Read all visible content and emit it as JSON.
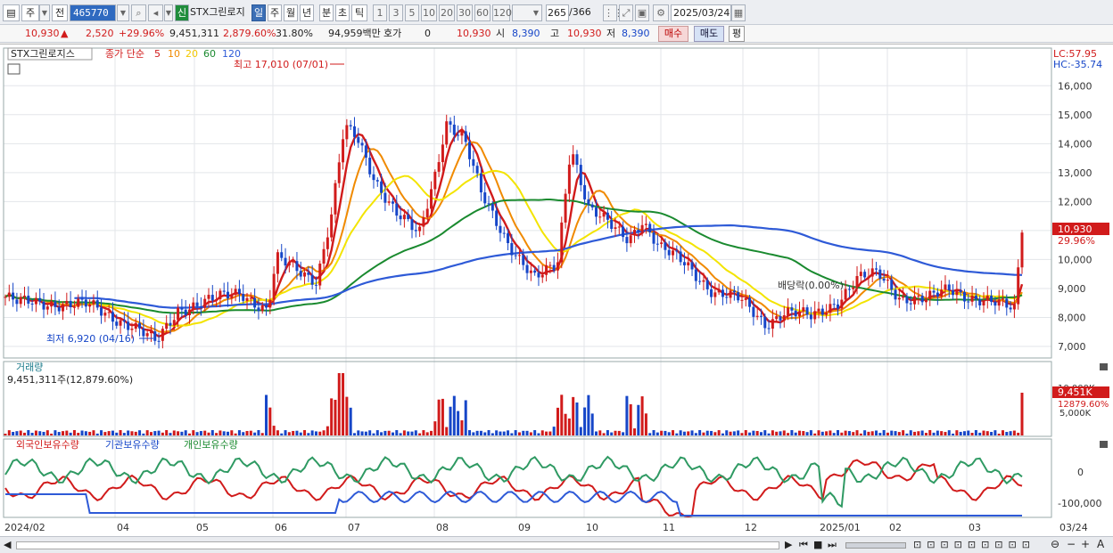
{
  "toolbar": {
    "period_type": "주",
    "prev_label": "전",
    "code": "465770",
    "new_badge": "신",
    "name": "STX그린로지",
    "periods": [
      "일",
      "주",
      "월",
      "년",
      "분",
      "초",
      "틱"
    ],
    "intervals": [
      "1",
      "3",
      "5",
      "10",
      "20",
      "30",
      "60",
      "120"
    ],
    "count": "265",
    "total": "/366",
    "date": "2025/03/24"
  },
  "quote": {
    "price": "10,930",
    "change": "2,520",
    "change_pct": "+29.96%",
    "volume": "9,451,311",
    "vol_pct": "2,879.60%",
    "turnover": "31.80%",
    "amount": "94,959백만",
    "hoga_label": "호가",
    "hoga_value": "0",
    "hoga_price": "10,930",
    "open_label": "시",
    "open": "8,390",
    "high_label": "고",
    "high": "10,930",
    "low_label": "저",
    "low": "8,390",
    "buy": "매수",
    "sell": "매도",
    "eval": "평"
  },
  "chart": {
    "stock_label": "STX그린로지스",
    "ma_label": "종가 단순",
    "ma_periods": [
      "5",
      "10",
      "20",
      "60",
      "120"
    ],
    "ma_colors": [
      "#d11b1b",
      "#f08a00",
      "#f3e400",
      "#1a8a2f",
      "#2e5ad7"
    ],
    "lc": "LC:57.95",
    "hc": "HC:-35.74",
    "high_note": "최고 17,010 (07/01)",
    "low_note": "최저 6,920 (04/16)",
    "dividend_note": "배당락(0.00%)",
    "price_ticks": [
      "16,000",
      "15,000",
      "14,000",
      "13,000",
      "12,000",
      "11,000",
      "10,000",
      "9,000",
      "8,000",
      "7,000"
    ],
    "cur_price_tag": "10,930",
    "cur_pct_tag": "29.96%",
    "volume_title": "거래량",
    "volume_value": "9,451,311주(12,879.60%)",
    "vol_ticks": [
      "10,000K",
      "5,000K"
    ],
    "vol_tag": "9,451K",
    "vol_pct_tag": "12879.60%",
    "holding_labels": [
      "외국인보유수량",
      "기관보유수량",
      "개인보유수량"
    ],
    "holding_ticks": [
      "0",
      "-100,000"
    ],
    "x_labels": [
      "2024/02",
      "04",
      "05",
      "06",
      "07",
      "08",
      "09",
      "10",
      "11",
      "12",
      "2025/01",
      "02",
      "03"
    ],
    "x_right": "03/24"
  },
  "chart_data": {
    "type": "candlestick",
    "title": "STX그린로지스",
    "key_points": [
      {
        "label": "최고",
        "date": "07/01",
        "value": 17010
      },
      {
        "label": "최저",
        "date": "04/16",
        "value": 6920
      },
      {
        "label": "current",
        "date": "2025/03/24",
        "value": 10930
      }
    ],
    "ylim": [
      6600,
      17300
    ],
    "volume": {
      "current": 9451311
    }
  }
}
